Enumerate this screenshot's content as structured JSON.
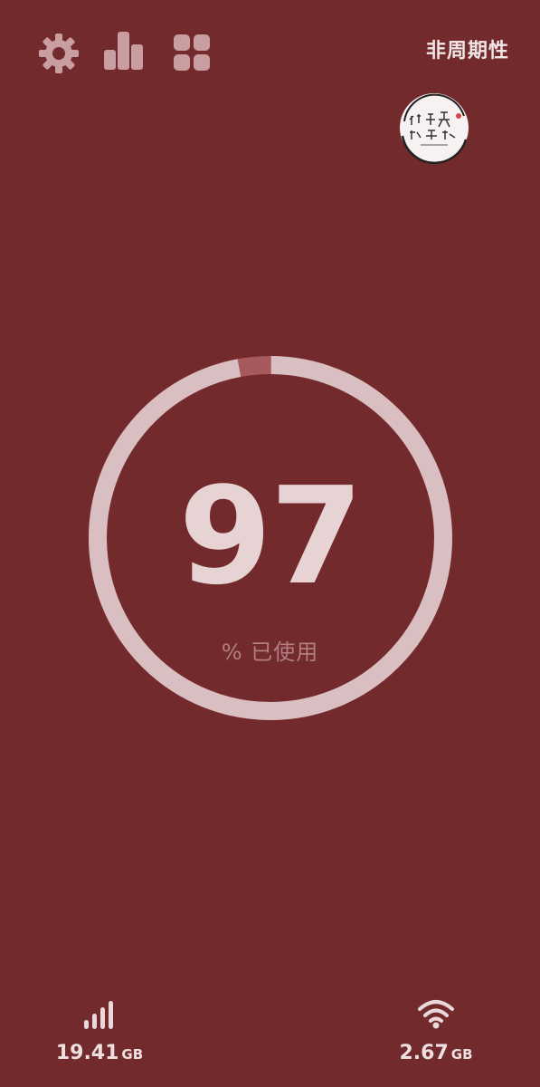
{
  "header": {
    "settings_icon": "gear-icon",
    "stats_icon": "bar-chart-icon",
    "widgets_icon": "grid-icon",
    "mode_label": "非周期性"
  },
  "logo": {
    "name": "watermark-logo",
    "text": "小丰大叔饭笑"
  },
  "gauge": {
    "value": "97",
    "caption": "% 已使用",
    "percent_used": 97
  },
  "stats": {
    "cellular": {
      "icon": "cellular-signal-icon",
      "value": "19.41",
      "unit": "GB"
    },
    "wifi": {
      "icon": "wifi-icon",
      "value": "2.67",
      "unit": "GB"
    }
  },
  "colors": {
    "background": "#732a2c",
    "ring": "#d9bfc1",
    "ring_gap": "#a65a5d",
    "icon": "#c79ea1",
    "text": "#e7d3d4"
  }
}
